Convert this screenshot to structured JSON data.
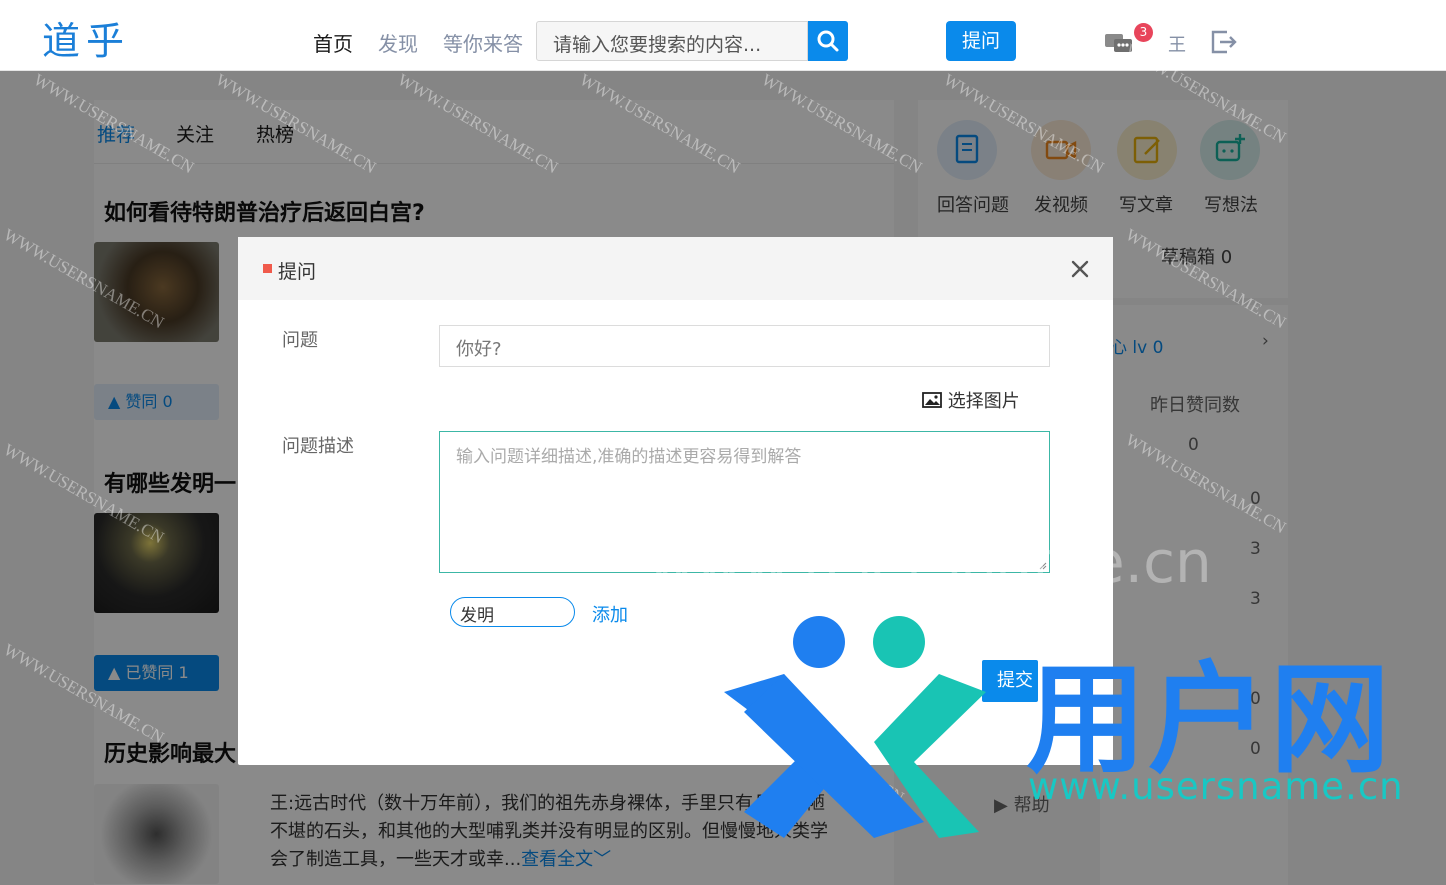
{
  "header": {
    "logo": "道乎",
    "nav": [
      "首页",
      "发现",
      "等你来答"
    ],
    "search_placeholder": "请输入您要搜索的内容...",
    "ask_button": "提问",
    "message_badge": "3",
    "user_name": "王"
  },
  "feed": {
    "tabs": [
      "推荐",
      "关注",
      "热榜"
    ],
    "items": [
      {
        "title": "如何看待特朗普治疗后返回白宫?",
        "vote": "赞同 0"
      },
      {
        "title": "有哪些发明一",
        "vote": "已赞同 1"
      },
      {
        "title": "历史影响最大",
        "excerpt": "王:远古时代（数十万年前），我们的祖先赤身裸体，手里只有几块粗陋不堪的石头，和其他的大型哺乳类并没有明显的区别。但慢慢地人类学会了制造工具，一些天才或幸...",
        "read_more": "查看全文"
      }
    ]
  },
  "sidebar": {
    "actions": [
      "回答问题",
      "发视频",
      "写文章",
      "写想法"
    ],
    "draft": "草稿箱 0",
    "creator": "心 lv 0",
    "yesterday": "昨日赞同数",
    "yesterday_value": "0",
    "stats": [
      "0",
      "3",
      "3",
      "0",
      "0"
    ],
    "help": "帮助"
  },
  "modal": {
    "title": "提问",
    "question_label": "问题",
    "question_value": "你好?",
    "pick_image": "选择图片",
    "desc_label": "问题描述",
    "desc_placeholder": "输入问题详细描述,准确的描述更容易得到解答",
    "tag_value": "发明",
    "add_tag": "添加",
    "submit": "提交"
  },
  "watermark": {
    "brand": "用户网",
    "url_small": "www.usersname.cn",
    "url_big": "www.usersname.cn",
    "diag": "WWW.USERSNAME.CN"
  },
  "colors": {
    "accent": "#0a8aeb",
    "badge": "#e8455b",
    "watermark_teal": "#18c8c4"
  }
}
